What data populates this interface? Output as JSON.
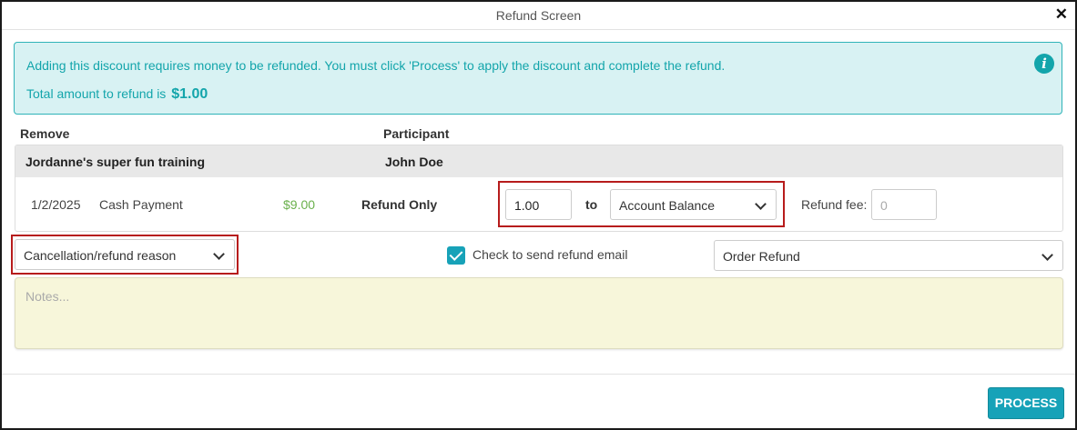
{
  "window": {
    "title": "Refund Screen",
    "close_glyph": "✕"
  },
  "alert": {
    "message": "Adding this discount requires money to be refunded. You must click 'Process' to apply the discount and complete the refund.",
    "total_label": "Total amount to refund is",
    "total_value": "$1.00",
    "icon": "info-icon",
    "color": "#13a5ab"
  },
  "table": {
    "headers": {
      "remove": "Remove",
      "participant": "Participant"
    },
    "group": {
      "name": "Jordanne's super fun training",
      "participant": "John Doe"
    },
    "row": {
      "date": "1/2/2025",
      "method": "Cash Payment",
      "amount": "$9.00",
      "type": "Refund Only",
      "refund_amount": "1.00",
      "to_label": "to",
      "destination": "Account Balance",
      "fee_label": "Refund fee:",
      "fee_placeholder": "0"
    }
  },
  "options": {
    "reason_select": "Cancellation/refund reason",
    "email_checkbox_label": "Check to send refund email",
    "email_checked": true,
    "email_template": "Order Refund"
  },
  "notes": {
    "placeholder": "Notes..."
  },
  "footer": {
    "process_label": "PROCESS"
  },
  "colors": {
    "accent": "#17a2b8",
    "highlight_border": "#b71c1c",
    "amount_green": "#6ab04c",
    "notes_bg": "#f7f6da"
  }
}
